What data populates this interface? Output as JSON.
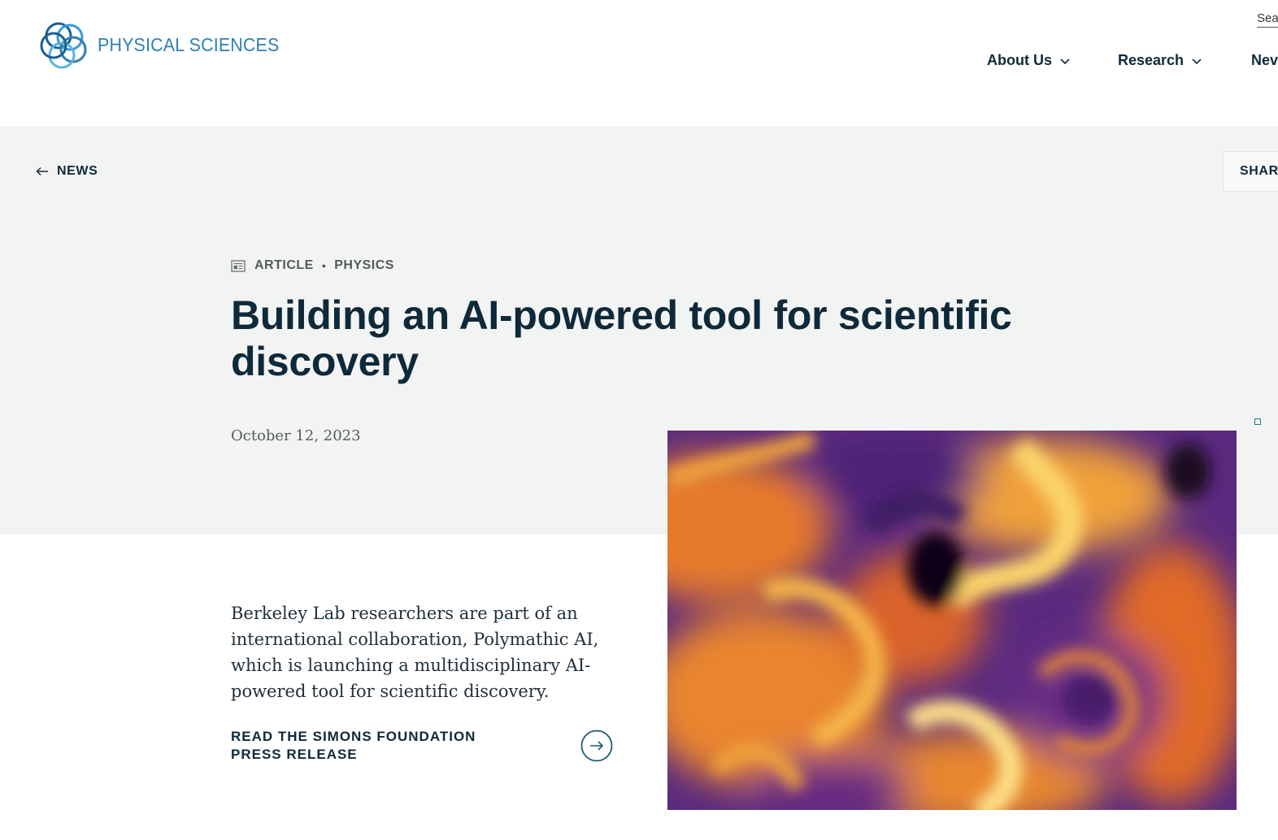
{
  "header": {
    "logo_text": "PHYSICAL SCIENCES",
    "search_label": "Sea",
    "nav": [
      {
        "label": "About Us"
      },
      {
        "label": "Research"
      },
      {
        "label": "Nev"
      }
    ]
  },
  "hero": {
    "back_label": "NEWS",
    "share_label": "SHAR",
    "content_type": "ARTICLE",
    "category": "PHYSICS",
    "title": "Building an AI-powered tool for scientific discovery",
    "date": "October 12, 2023"
  },
  "body": {
    "summary": "Berkeley Lab researchers are part of an international collaboration, Polymathic AI, which is launching a multidisciplinary AI-powered tool for scientific discovery.",
    "press_link": "READ THE SIMONS FOUNDATION PRESS RELEASE"
  },
  "icons": {
    "logo": "interlocking-rings-logo",
    "nav_chevron": "chevron-down-icon",
    "back": "arrow-left-icon",
    "article": "newspaper-icon",
    "press": "circle-arrow-right-icon"
  },
  "colors": {
    "brand_blue": "#2f7fb3",
    "navy_text": "#0e2a3a",
    "hero_background": "#f2f3f3"
  }
}
